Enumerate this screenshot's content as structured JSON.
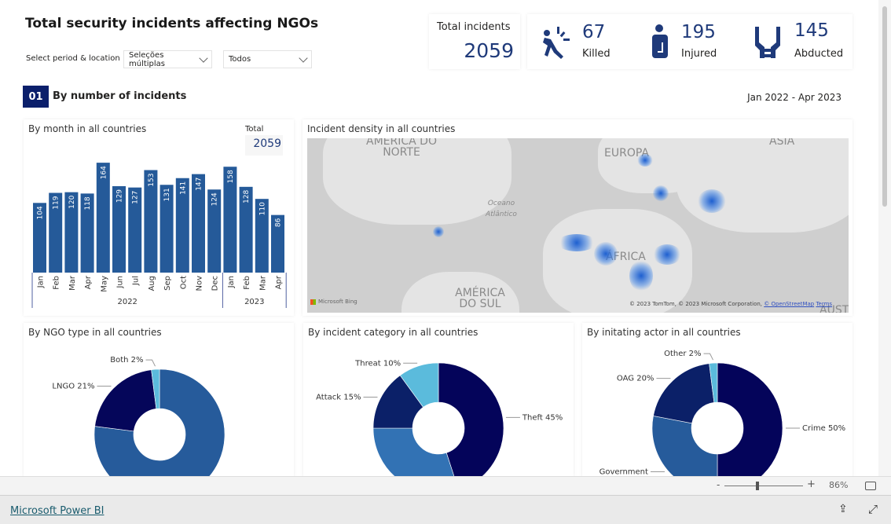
{
  "header": {
    "title": "Total security incidents affecting NGOs",
    "select_label": "Select period & location",
    "period_dropdown": "Seleções múltiplas",
    "location_dropdown": "Todos"
  },
  "kpis": {
    "total_label": "Total incidents",
    "total_value": "2059",
    "items": [
      {
        "icon": "falling-person-icon",
        "value": "67",
        "label": "Killed"
      },
      {
        "icon": "injured-person-icon",
        "value": "195",
        "label": "Injured"
      },
      {
        "icon": "bound-hands-icon",
        "value": "145",
        "label": "Abducted"
      }
    ]
  },
  "section": {
    "number": "01",
    "title": "By number of incidents",
    "period": "Jan 2022 - Apr 2023"
  },
  "map": {
    "title": "Incident density in all countries",
    "labels": [
      "AMÉRICA DO NORTE",
      "EUROPA",
      "ÁSIA",
      "Oceano Atlântico",
      "ÁFRICA",
      "AMÉRICA DO SUL",
      "AUST"
    ],
    "logo": "Microsoft Bing",
    "attribution": "© 2023 TomTom, © 2023 Microsoft Corporation, ",
    "osm_link": "© OpenStreetMap",
    "terms_link": "Terms"
  },
  "chart_data": [
    {
      "type": "bar",
      "title": "By month in all countries",
      "total_label": "Total",
      "total_value": "2059",
      "categories": [
        "Jan",
        "Feb",
        "Mar",
        "Apr",
        "May",
        "Jun",
        "Jul",
        "Aug",
        "Sep",
        "Oct",
        "Nov",
        "Dec",
        "Jan",
        "Feb",
        "Mar",
        "Apr"
      ],
      "groups": [
        {
          "label": "2022",
          "count": 12
        },
        {
          "label": "2023",
          "count": 4
        }
      ],
      "values": [
        104,
        119,
        120,
        118,
        164,
        129,
        127,
        153,
        131,
        141,
        147,
        124,
        158,
        128,
        110,
        86
      ],
      "color": "#255a99"
    },
    {
      "type": "pie",
      "title": "By NGO type in all countries",
      "slices": [
        {
          "label": "",
          "value": 77,
          "color": "#265b9b"
        },
        {
          "label": "LNGO 21%",
          "value": 21,
          "color": "#05065a"
        },
        {
          "label": "Both 2%",
          "value": 2,
          "color": "#5bbbdc"
        }
      ]
    },
    {
      "type": "pie",
      "title": "By incident category in all countries",
      "slices": [
        {
          "label": "Theft 45%",
          "value": 45,
          "color": "#04045a"
        },
        {
          "label": "",
          "value": 30,
          "color": "#3272b4"
        },
        {
          "label": "Attack 15%",
          "value": 15,
          "color": "#0b2068"
        },
        {
          "label": "Threat 10%",
          "value": 10,
          "color": "#5bbbdc"
        }
      ]
    },
    {
      "type": "pie",
      "title": "By initating actor in all countries",
      "slices": [
        {
          "label": "Crime 50%",
          "value": 50,
          "color": "#04045a"
        },
        {
          "label": "Government",
          "value": 28,
          "color": "#265b9b"
        },
        {
          "label": "OAG 20%",
          "value": 20,
          "color": "#0b2068"
        },
        {
          "label": "Other 2%",
          "value": 2,
          "color": "#5bbbdc"
        }
      ]
    }
  ],
  "statusbar": {
    "zoom_minus": "-",
    "zoom_plus": "+",
    "zoom_level": "86%"
  },
  "footer": {
    "brand_link": "Microsoft Power BI"
  }
}
